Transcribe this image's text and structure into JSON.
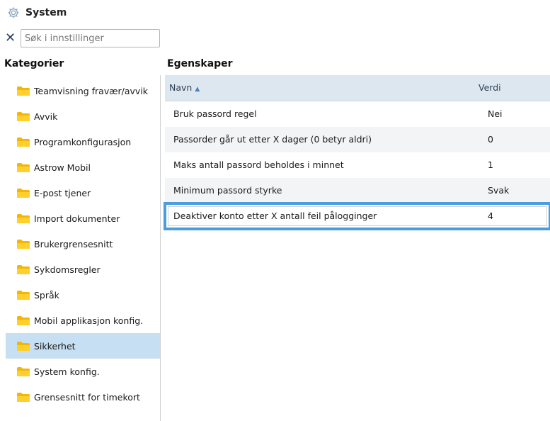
{
  "header": {
    "title": "System",
    "icon": "gear-icon"
  },
  "search": {
    "placeholder": "Søk i innstillinger",
    "value": ""
  },
  "sections": {
    "categories": "Kategorier",
    "properties": "Egenskaper"
  },
  "categories": [
    {
      "label": "Teamvisning fravær/avvik",
      "selected": false
    },
    {
      "label": "Avvik",
      "selected": false
    },
    {
      "label": "Programkonfigurasjon",
      "selected": false
    },
    {
      "label": "Astrow Mobil",
      "selected": false
    },
    {
      "label": "E-post tjener",
      "selected": false
    },
    {
      "label": "Import dokumenter",
      "selected": false
    },
    {
      "label": "Brukergrensesnitt",
      "selected": false
    },
    {
      "label": "Sykdomsregler",
      "selected": false
    },
    {
      "label": "Språk",
      "selected": false
    },
    {
      "label": "Mobil applikasjon konfig.",
      "selected": false
    },
    {
      "label": "Sikkerhet",
      "selected": true
    },
    {
      "label": "System konfig.",
      "selected": false
    },
    {
      "label": "Grensesnitt for timekort",
      "selected": false
    }
  ],
  "grid": {
    "columns": {
      "name": "Navn",
      "value": "Verdi"
    },
    "sort": "ascending",
    "rows": [
      {
        "name": "Bruk passord regel",
        "value": "Nei"
      },
      {
        "name": "Passorder går ut etter X dager (0 betyr aldri)",
        "value": "0"
      },
      {
        "name": "Maks antall passord beholdes i minnet",
        "value": "1"
      },
      {
        "name": "Minimum passord styrke",
        "value": "Svak"
      },
      {
        "name": "Deaktiver konto etter X antall feil pålogginger",
        "value": "4"
      }
    ]
  },
  "colors": {
    "selected": "#c7dff2",
    "header": "#dde7f0",
    "highlight": "#4a9ee0",
    "folder": "#f2b705"
  }
}
